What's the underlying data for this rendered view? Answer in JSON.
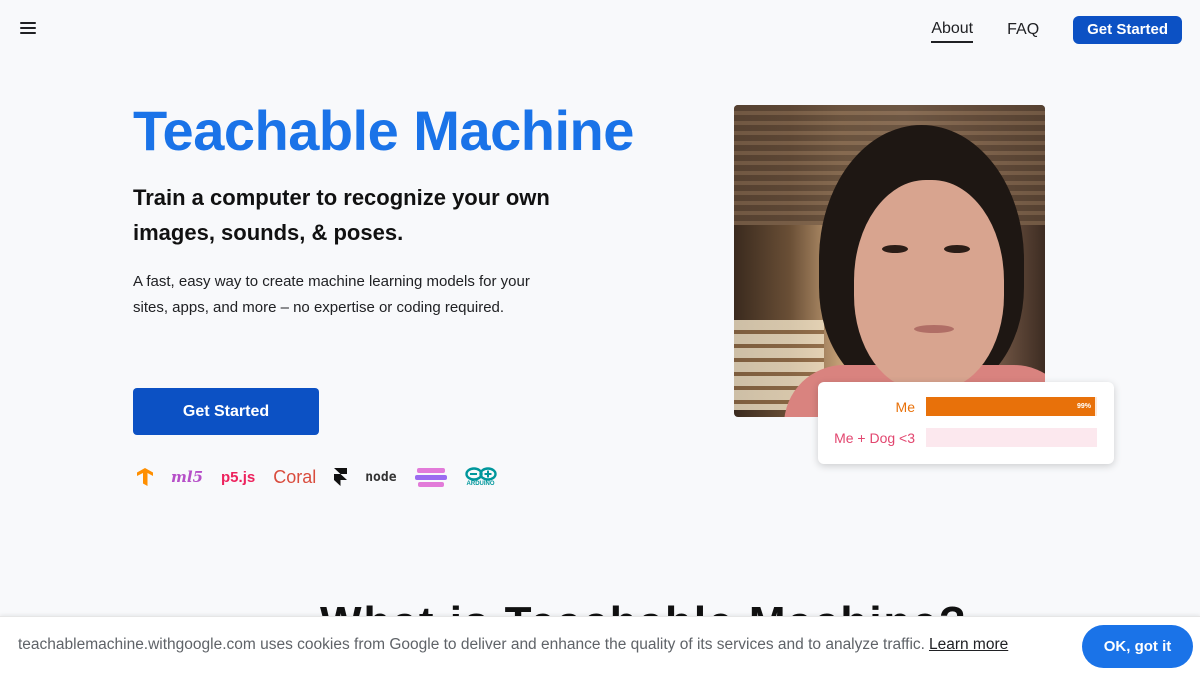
{
  "header": {
    "menu_icon": "hamburger-menu-icon",
    "nav": [
      {
        "label": "About",
        "active": true
      },
      {
        "label": "FAQ",
        "active": false
      }
    ],
    "cta_label": "Get Started",
    "accent_color": "#0c51c4"
  },
  "hero": {
    "title": "Teachable Machine",
    "subtitle": "Train a computer to recognize your own images, sounds, & poses.",
    "description": "A fast, easy way to create machine learning models for your sites, apps, and more – no expertise or coding required.",
    "cta_label": "Get Started",
    "title_color": "#1a73e8"
  },
  "logos": [
    {
      "name": "tensorflow-logo",
      "text": ""
    },
    {
      "name": "ml5-logo",
      "text": "ml5"
    },
    {
      "name": "p5js-logo",
      "text": "p5.js"
    },
    {
      "name": "coral-logo",
      "text": "Coral"
    },
    {
      "name": "framer-logo",
      "text": ""
    },
    {
      "name": "node-logo",
      "text": "node"
    },
    {
      "name": "glitch-logo",
      "text": ""
    },
    {
      "name": "arduino-logo",
      "text": "ARDUINO"
    }
  ],
  "prediction": {
    "classes": [
      {
        "label": "Me",
        "confidence": 0.99,
        "percent_text": "99%",
        "color": "#e8710a",
        "track": "#fde9d8"
      },
      {
        "label": "Me + Dog <3",
        "confidence": 0.0,
        "percent_text": "",
        "color": "#e2466f",
        "track": "#fce8ee"
      }
    ]
  },
  "section_heading_partial": "What is Teachable Machine?",
  "cookie": {
    "text": "teachablemachine.withgoogle.com uses cookies from Google to deliver and enhance the quality of its services and to analyze traffic.",
    "link_label": "Learn more",
    "button_label": "OK, got it"
  }
}
